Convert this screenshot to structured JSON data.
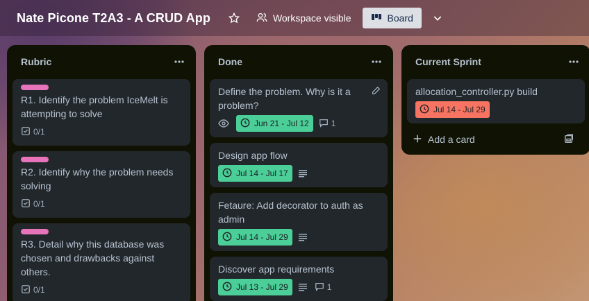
{
  "board": {
    "title": "Nate Picone T2A3 - A CRUD App",
    "visibility_label": "Workspace visible",
    "view_label": "Board"
  },
  "colors": {
    "label_pink": "#e774bb",
    "date_green": "#4bce97",
    "date_red": "#f87462",
    "list_bg": "#101204",
    "card_bg": "#22272b"
  },
  "lists": [
    {
      "title": "Rubric",
      "cards": [
        {
          "label": "pink",
          "title": "R1. Identify the problem IceMelt is attempting to solve",
          "checklist": "0/1"
        },
        {
          "label": "pink",
          "title": "R2. Identify why the problem needs solving",
          "checklist": "0/1"
        },
        {
          "label": "pink",
          "title": "R3. Detail why this database was chosen and drawbacks against others.",
          "checklist": "0/1"
        }
      ]
    },
    {
      "title": "Done",
      "cards": [
        {
          "title": "Define the problem. Why is it a problem?",
          "watching": true,
          "dates": "Jun 21 - Jul 12",
          "comments": "1"
        },
        {
          "title": "Design app flow",
          "dates": "Jul 14 - Jul 17",
          "description": true
        },
        {
          "title": "Fetaure: Add decorator to auth as admin",
          "dates": "Jul 14 - Jul 29",
          "description": true
        },
        {
          "title": "Discover app requirements",
          "dates": "Jul 13 - Jul 29",
          "description": true,
          "comments": "1"
        }
      ]
    },
    {
      "title": "Current Sprint",
      "cards": [
        {
          "title": "allocation_controller.py build",
          "dates": "Jul 14 - Jul 29",
          "overdue": true
        }
      ],
      "add_card_label": "Add a card"
    }
  ]
}
